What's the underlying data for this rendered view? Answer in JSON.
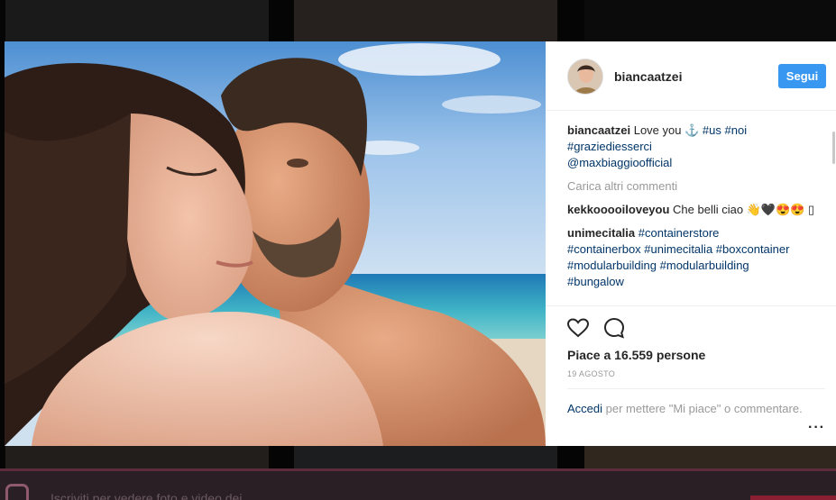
{
  "post": {
    "username": "biancaatzei",
    "follow_label": "Segui"
  },
  "caption": {
    "user": "biancaatzei",
    "text": "Love you ⚓",
    "tags": [
      "#us",
      "#noi",
      "#graziediesserci",
      "@maxbiaggioofficial"
    ]
  },
  "load_more": "Carica altri commenti",
  "comments": [
    {
      "user": "kekkooooiloveyou",
      "text": "Che belli ciao 👋🖤😍😍 ▯"
    },
    {
      "user": "unimecitalia",
      "tags": [
        "#containerstore",
        "#containerbox",
        "#unimecitalia",
        "#boxcontainer",
        "#modularbuilding",
        "#modularbuilding",
        "#bungalow"
      ]
    }
  ],
  "likes": "Piace a 16.559 persone",
  "date": "19 agosto",
  "login": {
    "link": "Accedi",
    "text": "per mettere \"Mi piace\" o commentare."
  },
  "more_icon": "···",
  "footer": {
    "signup_text": "Iscriviti per vedere foto e video dei"
  },
  "icons": {
    "heart": "heart-outline-icon",
    "comment": "comment-bubble-icon",
    "more": "ellipsis-icon",
    "instagram": "instagram-logo-icon"
  },
  "colors": {
    "follow": "#3897f0",
    "link": "#003569"
  }
}
